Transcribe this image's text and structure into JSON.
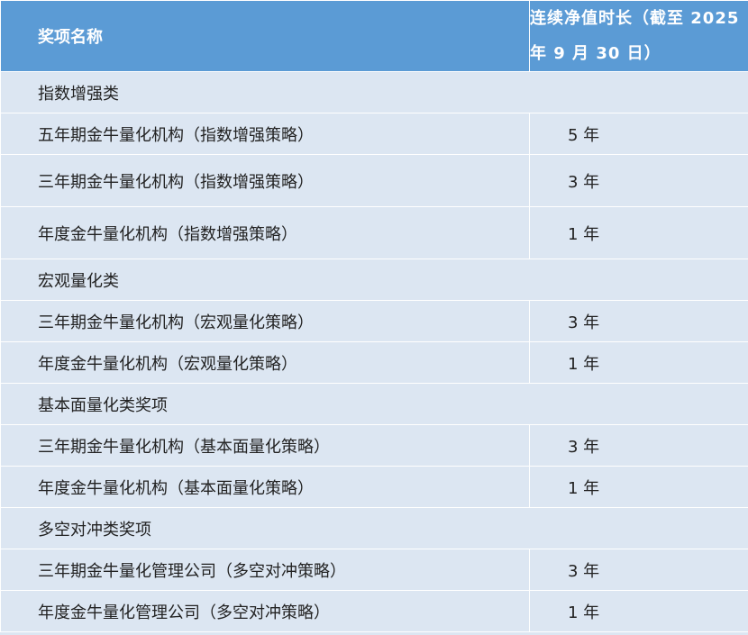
{
  "header": {
    "name_label": "奖项名称",
    "duration_label": "连续净值时长（截至 2025 年 9 月 30 日）"
  },
  "sections": [
    {
      "category": "指数增强类",
      "rows": [
        {
          "name": "五年期金牛量化机构（指数增强策略）",
          "value": "5 年"
        },
        {
          "name": "三年期金牛量化机构（指数增强策略）",
          "value": "3 年"
        },
        {
          "name": "年度金牛量化机构（指数增强策略）",
          "value": "1 年"
        }
      ]
    },
    {
      "category": "宏观量化类",
      "rows": [
        {
          "name": "三年期金牛量化机构（宏观量化策略）",
          "value": "3 年"
        },
        {
          "name": "年度金牛量化机构（宏观量化策略）",
          "value": "1 年"
        }
      ]
    },
    {
      "category": "基本面量化类奖项",
      "rows": [
        {
          "name": "三年期金牛量化机构（基本面量化策略）",
          "value": "3 年"
        },
        {
          "name": "年度金牛量化机构（基本面量化策略）",
          "value": "1 年"
        }
      ]
    },
    {
      "category": "多空对冲类奖项",
      "rows": [
        {
          "name": "三年期金牛量化管理公司（多空对冲策略）",
          "value": "3 年"
        },
        {
          "name": "年度金牛量化管理公司（多空对冲策略）",
          "value": "1 年"
        }
      ]
    }
  ]
}
